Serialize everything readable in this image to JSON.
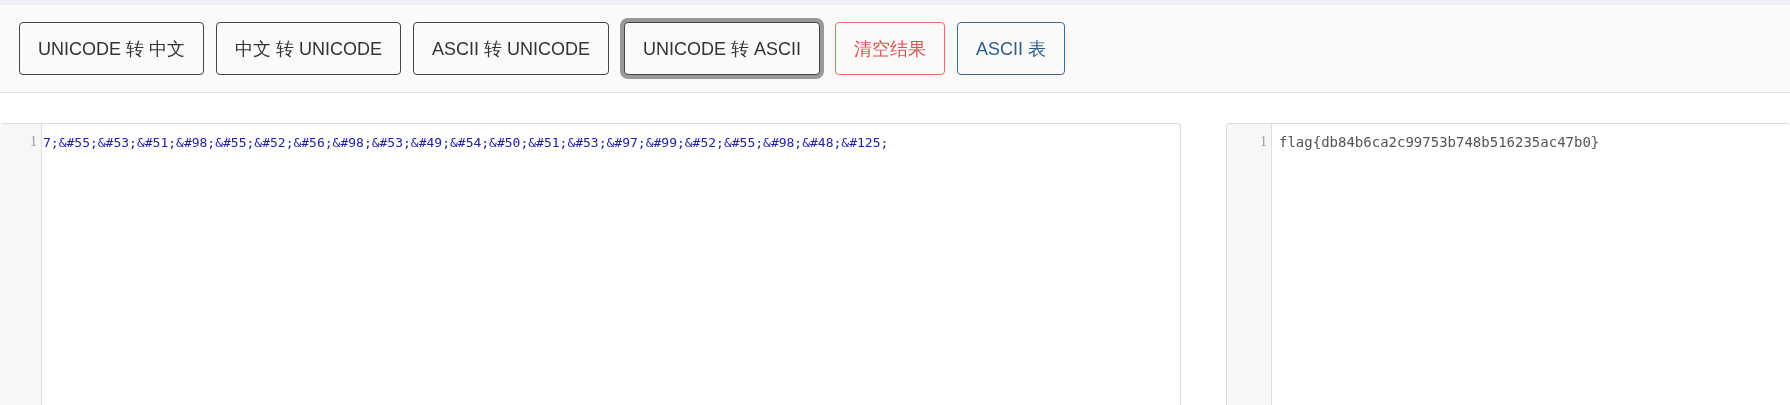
{
  "toolbar": {
    "buttons": [
      {
        "label": "UNICODE 转 中文",
        "kind": "default",
        "focused": false
      },
      {
        "label": "中文 转 UNICODE",
        "kind": "default",
        "focused": false
      },
      {
        "label": "ASCII 转 UNICODE",
        "kind": "default",
        "focused": false
      },
      {
        "label": "UNICODE 转 ASCII",
        "kind": "default",
        "focused": true
      },
      {
        "label": "清空结果",
        "kind": "danger",
        "focused": false
      },
      {
        "label": "ASCII 表",
        "kind": "primary",
        "focused": false
      }
    ]
  },
  "input_editor": {
    "lines": [
      {
        "number": "1",
        "text": "7;&#55;&#53;&#51;&#98;&#55;&#52;&#56;&#98;&#53;&#49;&#54;&#50;&#51;&#53;&#97;&#99;&#52;&#55;&#98;&#48;&#125;"
      }
    ]
  },
  "output_editor": {
    "lines": [
      {
        "number": "1",
        "text": "flag{db84b6ca2c99753b748b516235ac47b0}"
      }
    ]
  }
}
